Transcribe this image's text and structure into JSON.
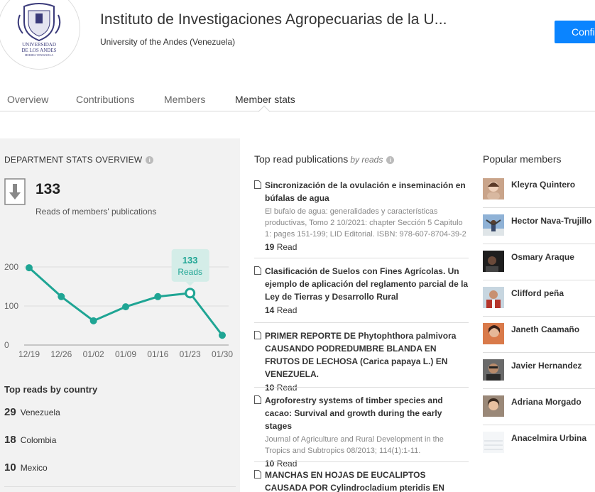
{
  "header": {
    "logo_text_1": "UNIVERSIDAD",
    "logo_text_2": "DE LOS ANDES",
    "logo_text_3": "MERIDA VENEZUELA",
    "title": "Instituto de Investigaciones Agropecuarias de la U...",
    "subtitle": "University of the Andes (Venezuela)",
    "confirm_label": "Confi"
  },
  "tabs": [
    {
      "label": "Overview"
    },
    {
      "label": "Contributions"
    },
    {
      "label": "Members"
    },
    {
      "label": "Member stats",
      "active": true
    }
  ],
  "stats": {
    "header": "DEPARTMENT STATS OVERVIEW",
    "total_reads": "133",
    "caption": "Reads of members' publications",
    "tooltip_value": "133",
    "tooltip_label": "Reads"
  },
  "chart_data": {
    "type": "line",
    "x": [
      "12/19",
      "12/26",
      "01/02",
      "01/09",
      "01/16",
      "01/23",
      "01/30"
    ],
    "series": [
      {
        "values": [
          198,
          124,
          62,
          98,
          124,
          133,
          25
        ]
      }
    ],
    "yticks": [
      "0",
      "100",
      "200"
    ],
    "ylim": [
      0,
      240
    ],
    "highlight_index": 5,
    "color": "#1fa594"
  },
  "countries": {
    "title": "Top reads by country",
    "items": [
      {
        "count": "29",
        "name": "Venezuela"
      },
      {
        "count": "18",
        "name": "Colombia"
      },
      {
        "count": "10",
        "name": "Mexico"
      }
    ]
  },
  "publications": {
    "header": "Top read publications",
    "header_suffix": "by reads",
    "items": [
      {
        "title": "Sincronización de la ovulación e inseminación en búfalas de agua",
        "meta": "El bufalo de agua: generalidades y características productivas, Tomo 2 10/2021: chapter Sección 5 Capitulo 1: pages 151-199; LID Editorial. ISBN: 978-607-8704-39-2",
        "reads_count": "19",
        "reads_label": "Read"
      },
      {
        "title": "Clasificación de Suelos con Fines Agrícolas. Un ejemplo de aplicación del reglamento parcial de la Ley de Tierras y Desarrollo Rural",
        "meta": "",
        "reads_count": "14",
        "reads_label": "Read"
      },
      {
        "title": "PRIMER REPORTE DE Phytophthora palmivora CAUSANDO PODREDUMBRE BLANDA EN FRUTOS DE LECHOSA (Carica papaya L.) EN VENEZUELA.",
        "meta": "",
        "reads_count": "10",
        "reads_label": "Read"
      },
      {
        "title": "Agroforestry systems of timber species and cacao: Survival and growth during the early stages",
        "meta": "Journal of Agriculture and Rural Development in the Tropics and Subtropics 08/2013; 114(1):1-11.",
        "reads_count": "10",
        "reads_label": "Read"
      },
      {
        "title": "MANCHAS EN HOJAS DE EUCALIPTOS CAUSADA POR Cylindrocladium pteridis EN PORTUGUESA",
        "meta": "",
        "reads_count": "",
        "reads_label": ""
      }
    ]
  },
  "members": {
    "header": "Popular members",
    "items": [
      {
        "name": "Kleyra Quintero",
        "avatar_color": "#c9a48a"
      },
      {
        "name": "Hector Nava-Trujillo",
        "avatar_color": "#6e8fb5"
      },
      {
        "name": "Osmary Araque",
        "avatar_color": "#2b2b2b"
      },
      {
        "name": "Clifford peña",
        "avatar_color": "#b5342a"
      },
      {
        "name": "Janeth Caamaño",
        "avatar_color": "#a05a3a"
      },
      {
        "name": "Javier Hernandez",
        "avatar_color": "#4a3a30"
      },
      {
        "name": "Adriana Morgado",
        "avatar_color": "#b88a6a"
      },
      {
        "name": "Anacelmira Urbina",
        "avatar_color": "#e8ecef"
      }
    ]
  }
}
